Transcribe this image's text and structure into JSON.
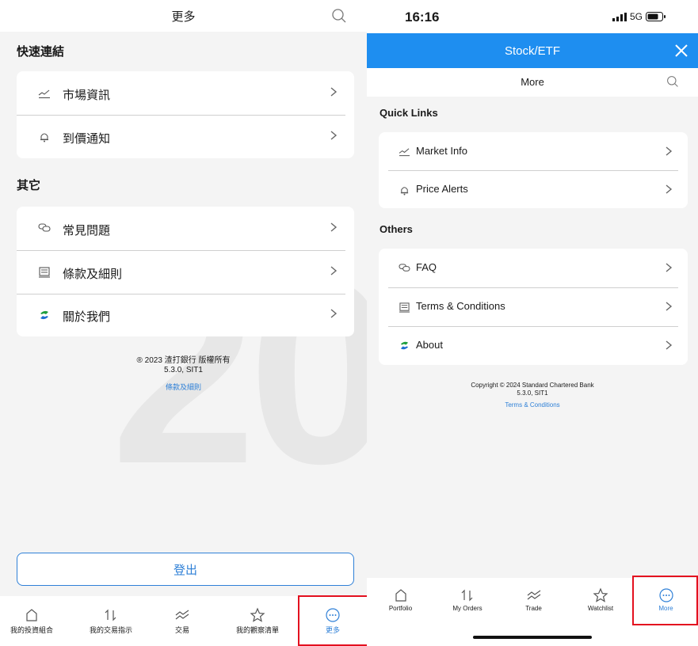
{
  "left": {
    "header_title": "更多",
    "quick_links_title": "快速連結",
    "quick_links": [
      {
        "label": "市場資訊",
        "icon": "market-info-icon"
      },
      {
        "label": "到價通知",
        "icon": "bell-icon"
      }
    ],
    "others_title": "其它",
    "others": [
      {
        "label": "常見問題",
        "icon": "faq-icon"
      },
      {
        "label": "條款及細則",
        "icon": "document-icon"
      },
      {
        "label": "關於我們",
        "icon": "sc-logo-icon"
      }
    ],
    "watermark": "20",
    "copyright_line1": "® 2023 渣打銀行 版權所有",
    "copyright_line2": "5.3.0, SIT1",
    "terms_link": "條款及細則",
    "logout_label": "登出",
    "tabs": [
      {
        "label": "我的投資組合",
        "icon": "home-icon"
      },
      {
        "label": "我的交易指示",
        "icon": "transfer-icon"
      },
      {
        "label": "交易",
        "icon": "trend-icon"
      },
      {
        "label": "我的觀察清單",
        "icon": "star-icon"
      },
      {
        "label": "更多",
        "icon": "more-icon"
      }
    ]
  },
  "right": {
    "status_time": "16:16",
    "network": "5G",
    "bar_title": "Stock/ETF",
    "sub_title": "More",
    "quick_links_title": "Quick Links",
    "quick_links": [
      {
        "label": "Market Info",
        "icon": "market-info-icon"
      },
      {
        "label": "Price Alerts",
        "icon": "bell-icon"
      }
    ],
    "others_title": "Others",
    "others": [
      {
        "label": "FAQ",
        "icon": "faq-icon"
      },
      {
        "label": "Terms & Conditions",
        "icon": "document-icon"
      },
      {
        "label": "About",
        "icon": "sc-logo-icon"
      }
    ],
    "copyright_line1": "Copyright © 2024 Standard Chartered Bank",
    "copyright_line2": "5.3.0, SIT1",
    "terms_link": "Terms & Conditions",
    "tabs": [
      {
        "label": "Portfolio",
        "icon": "home-icon"
      },
      {
        "label": "My Orders",
        "icon": "transfer-icon"
      },
      {
        "label": "Trade",
        "icon": "trend-icon"
      },
      {
        "label": "Watchlist",
        "icon": "star-icon"
      },
      {
        "label": "More",
        "icon": "more-icon"
      }
    ]
  },
  "colors": {
    "accent_blue": "#2f80d7",
    "bar_blue": "#1e8ef0",
    "highlight_red": "#e3101f"
  }
}
